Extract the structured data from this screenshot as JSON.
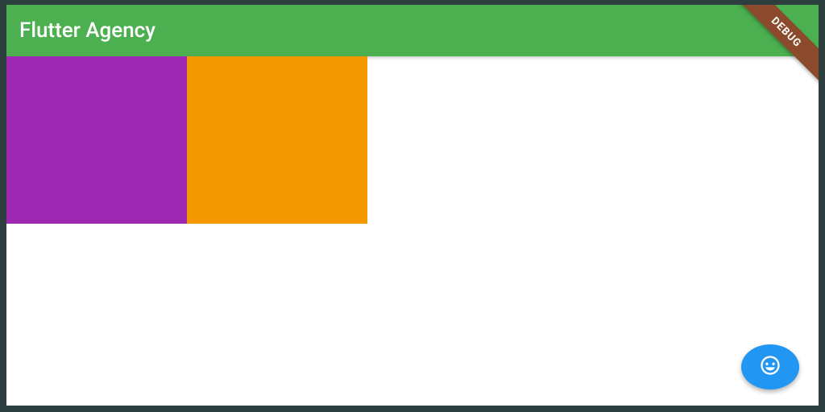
{
  "appBar": {
    "title": "Flutter Agency",
    "backgroundColor": "#4CAF50"
  },
  "debugBanner": {
    "label": "DEBUG",
    "color": "#8B4A2B"
  },
  "body": {
    "boxes": [
      {
        "color": "#9C27B0",
        "name": "purple"
      },
      {
        "color": "#F39800",
        "name": "orange"
      }
    ]
  },
  "fab": {
    "iconName": "smiley-icon",
    "backgroundColor": "#2196F3"
  }
}
